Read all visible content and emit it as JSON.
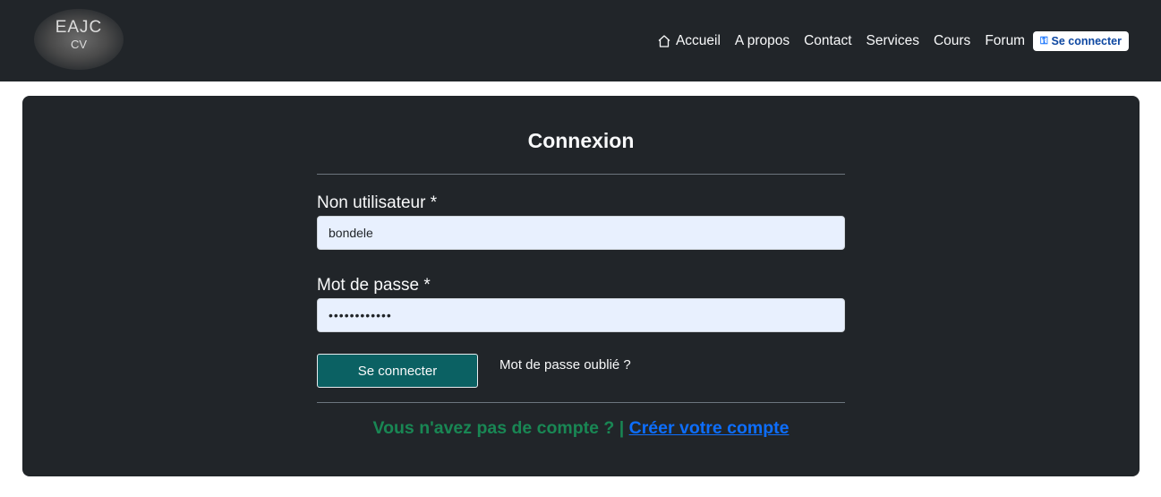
{
  "brand": {
    "line1": "EAJC",
    "line2": "CV"
  },
  "nav": {
    "items": [
      {
        "label": "Accueil",
        "icon": "home-icon"
      },
      {
        "label": "A propos"
      },
      {
        "label": "Contact"
      },
      {
        "label": "Services"
      },
      {
        "label": "Cours"
      },
      {
        "label": "Forum"
      }
    ],
    "login_label": "Se connecter",
    "login_icon": "key-icon"
  },
  "form": {
    "title": "Connexion",
    "username_label": "Non utilisateur *",
    "username_value": "bondele",
    "password_label": "Mot de passe *",
    "password_value": "••••••••••••",
    "submit_label": "Se connecter",
    "forgot_label": "Mot de passe oublié ?",
    "signup_question": "Vous n'avez pas de compte ?",
    "signup_separator": "|",
    "signup_link": "Créer votre compte"
  },
  "colors": {
    "navbar_bg": "#212529",
    "card_bg": "#212529",
    "submit_bg": "#0b6163",
    "input_bg": "#e8f0fe",
    "signup_text": "#198754",
    "link": "#0d6efd"
  }
}
